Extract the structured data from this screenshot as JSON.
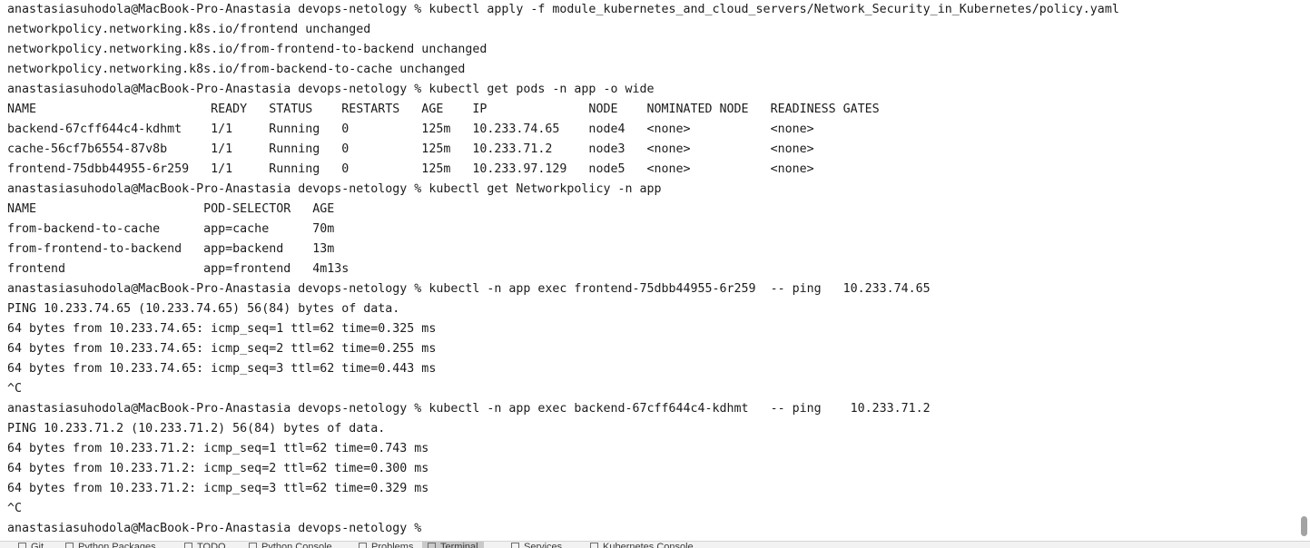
{
  "terminal": {
    "lines": [
      "anastasiasuhodola@MacBook-Pro-Anastasia devops-netology % kubectl apply -f module_kubernetes_and_cloud_servers/Network_Security_in_Kubernetes/policy.yaml",
      "networkpolicy.networking.k8s.io/frontend unchanged",
      "networkpolicy.networking.k8s.io/from-frontend-to-backend unchanged",
      "networkpolicy.networking.k8s.io/from-backend-to-cache unchanged",
      "anastasiasuhodola@MacBook-Pro-Anastasia devops-netology % kubectl get pods -n app -o wide",
      "NAME                        READY   STATUS    RESTARTS   AGE    IP              NODE    NOMINATED NODE   READINESS GATES",
      "backend-67cff644c4-kdhmt    1/1     Running   0          125m   10.233.74.65    node4   <none>           <none>",
      "cache-56cf7b6554-87v8b      1/1     Running   0          125m   10.233.71.2     node3   <none>           <none>",
      "frontend-75dbb44955-6r259   1/1     Running   0          125m   10.233.97.129   node5   <none>           <none>",
      "anastasiasuhodola@MacBook-Pro-Anastasia devops-netology % kubectl get Networkpolicy -n app",
      "NAME                       POD-SELECTOR   AGE",
      "from-backend-to-cache      app=cache      70m",
      "from-frontend-to-backend   app=backend    13m",
      "frontend                   app=frontend   4m13s",
      "anastasiasuhodola@MacBook-Pro-Anastasia devops-netology % kubectl -n app exec frontend-75dbb44955-6r259  -- ping   10.233.74.65",
      "PING 10.233.74.65 (10.233.74.65) 56(84) bytes of data.",
      "64 bytes from 10.233.74.65: icmp_seq=1 ttl=62 time=0.325 ms",
      "64 bytes from 10.233.74.65: icmp_seq=2 ttl=62 time=0.255 ms",
      "64 bytes from 10.233.74.65: icmp_seq=3 ttl=62 time=0.443 ms",
      "^C",
      "anastasiasuhodola@MacBook-Pro-Anastasia devops-netology % kubectl -n app exec backend-67cff644c4-kdhmt   -- ping    10.233.71.2",
      "PING 10.233.71.2 (10.233.71.2) 56(84) bytes of data.",
      "64 bytes from 10.233.71.2: icmp_seq=1 ttl=62 time=0.743 ms",
      "64 bytes from 10.233.71.2: icmp_seq=2 ttl=62 time=0.300 ms",
      "64 bytes from 10.233.71.2: icmp_seq=3 ttl=62 time=0.329 ms",
      "^C",
      "anastasiasuhodola@MacBook-Pro-Anastasia devops-netology % "
    ]
  },
  "tool_window_bar": {
    "tabs": [
      {
        "label": "Git",
        "icon": "git-branch-icon",
        "active": false
      },
      {
        "label": "Python Packages",
        "icon": "packages-icon",
        "active": false
      },
      {
        "label": "TODO",
        "icon": "todo-list-icon",
        "active": false
      },
      {
        "label": "Python Console",
        "icon": "python-console-icon",
        "active": false
      },
      {
        "label": "Problems",
        "icon": "problems-icon",
        "active": false
      },
      {
        "label": "Terminal",
        "icon": "terminal-icon",
        "active": true
      },
      {
        "label": "Services",
        "icon": "services-icon",
        "active": false
      },
      {
        "label": "Kubernetes Console",
        "icon": "kubernetes-console-icon",
        "active": false
      }
    ]
  },
  "colors": {
    "text": "#1b1b1b",
    "background": "#ffffff",
    "scrollbar_thumb": "#a3a3a3",
    "tool_bar_background": "#f2f2f2",
    "active_tab": "#c9c9c9"
  }
}
